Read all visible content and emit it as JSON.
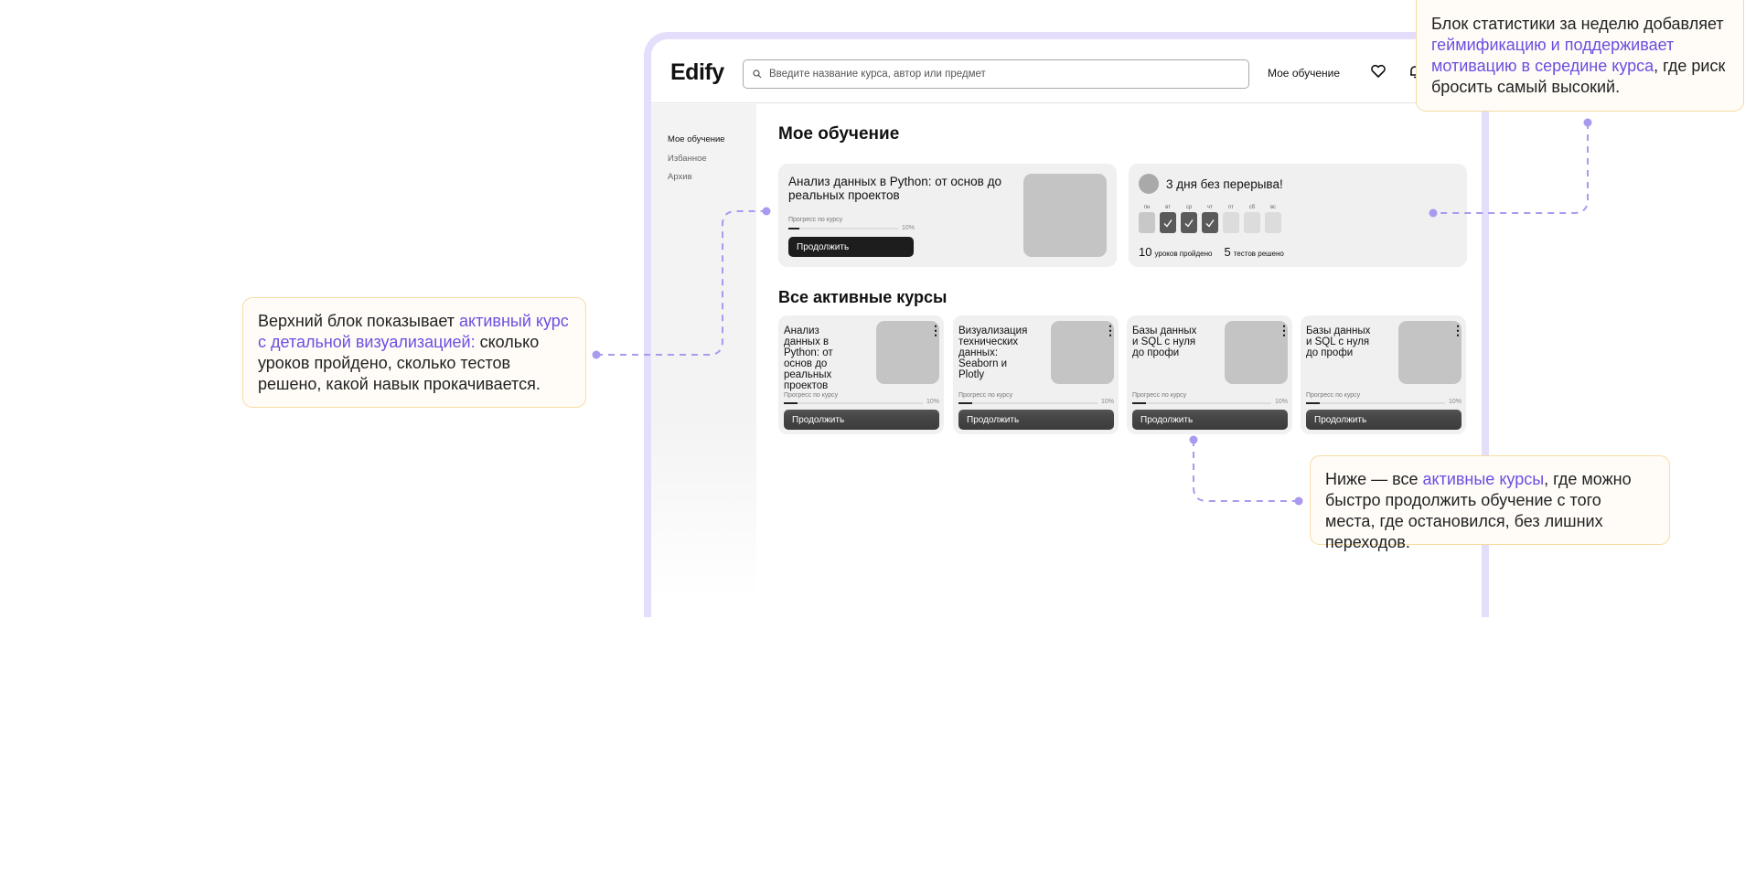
{
  "app": {
    "logo": "Edify",
    "search_placeholder": "Введите название курса, автор или предмет",
    "nav_link": "Мое обучение"
  },
  "sidebar": {
    "items": [
      {
        "label": "Мое обучение"
      },
      {
        "label": "Избанное"
      },
      {
        "label": "Архив"
      }
    ]
  },
  "main": {
    "title": "Мое обучение",
    "current_course": {
      "title": "Анализ данных в Python: от основ до реальных проектов",
      "progress_label": "Прогресс по курсу",
      "progress": 10,
      "progress_text": "10%",
      "button": "Продолжить"
    },
    "streak": {
      "title": "3 дня без перерыва!",
      "days": [
        {
          "label": "пн",
          "done": false
        },
        {
          "label": "вт",
          "done": true
        },
        {
          "label": "ср",
          "done": true
        },
        {
          "label": "чт",
          "done": true
        },
        {
          "label": "пт",
          "done": false
        },
        {
          "label": "сб",
          "done": false
        },
        {
          "label": "вс",
          "done": false
        }
      ],
      "lessons_count": "10",
      "lessons_label": "уроков пройдено",
      "tests_count": "5",
      "tests_label": "тестов решено"
    },
    "active_title": "Все активные курсы",
    "courses": [
      {
        "title": "Анализ данных в Python: от основ до реальных проектов",
        "progress_label": "Прогресс по курсу",
        "progress_text": "10%",
        "button": "Продолжить"
      },
      {
        "title": "Визуализация технических данных: Seaborn и Plotly",
        "progress_label": "Прогресс по курсу",
        "progress_text": "10%",
        "button": "Продолжить"
      },
      {
        "title": "Базы данных и SQL с нуля до профи",
        "progress_label": "Прогресс по курсу",
        "progress_text": "10%",
        "button": "Продолжить"
      },
      {
        "title": "Базы данных и SQL с нуля до профи",
        "progress_label": "Прогресс по курсу",
        "progress_text": "10%",
        "button": "Продолжить"
      }
    ]
  },
  "callouts": {
    "left": {
      "a": "Верхний блок показывает ",
      "hl": "активный курс с детальной визуализацией:",
      "b": " сколько уроков пройдено, сколько тестов решено, какой навык прокачивается."
    },
    "top_right": {
      "a": "Блок статистики за неделю добавляет ",
      "hl": "геймификацию и поддерживает мотивацию в середине курса",
      "b": ", где риск бросить самый высокий."
    },
    "bottom": {
      "a": "Ниже — все ",
      "hl": "активные курсы",
      "b": ", где можно быстро продолжить обучение с того места, где остановился, без лишних переходов."
    }
  },
  "colors": {
    "accent": "#6a4fe0",
    "frame": "#e4defb",
    "callout_border": "#f7dba2"
  }
}
